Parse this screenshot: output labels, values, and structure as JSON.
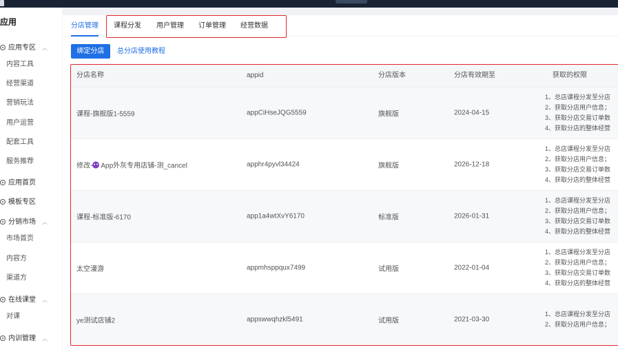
{
  "sidebar": {
    "title": "应用",
    "groups": [
      {
        "label": "应用专区",
        "icon": "app-zone-icon",
        "children": [
          "内容工具",
          "经营渠道",
          "营销玩法",
          "用户运营",
          "配套工具",
          "服务推荐"
        ]
      },
      {
        "label": "应用首页",
        "icon": "app-home-icon",
        "children": []
      },
      {
        "label": "模板专区",
        "icon": "template-icon",
        "children": []
      },
      {
        "label": "分销市场",
        "icon": "distribution-market-icon",
        "children": [
          "市场首页",
          "内容方",
          "渠道方"
        ]
      },
      {
        "label": "在线课堂",
        "icon": "online-class-icon",
        "children": [
          "对课"
        ]
      },
      {
        "label": "内训管理",
        "icon": "training-icon",
        "children": []
      }
    ]
  },
  "tabs": [
    {
      "label": "分店管理",
      "active": true
    },
    {
      "label": "课程分发",
      "active": false
    },
    {
      "label": "用户管理",
      "active": false
    },
    {
      "label": "订单管理",
      "active": false
    },
    {
      "label": "经营数据",
      "active": false
    }
  ],
  "actions": {
    "bind_button": "绑定分店",
    "tutorial_link": "总分店使用教程"
  },
  "table": {
    "columns": [
      "分店名称",
      "appid",
      "分店版本",
      "分店有效期至",
      "获取的权限"
    ],
    "rows": [
      {
        "name": "课程-旗舰版1-5559",
        "has_emoji": false,
        "appid": "appCiHseJQG5559",
        "version": "旗舰版",
        "expire": "2024-04-15",
        "perms": [
          "1、总店课程分发至分店",
          "2、获取分店用户信息；",
          "3、获取分店交易订单数",
          "4、获取分店的整体经营"
        ]
      },
      {
        "name_prefix": "修改-",
        "name": "App外灰专用店铺-测_cancel",
        "has_emoji": true,
        "appid": "apphr4pyvl34424",
        "version": "旗舰版",
        "expire": "2026-12-18",
        "perms": [
          "1、总店课程分发至分店",
          "2、获取分店用户信息；",
          "3、获取分店交易订单数",
          "4、获取分店的整体经营"
        ]
      },
      {
        "name": "课程-标准版-6170",
        "has_emoji": false,
        "appid": "app1a4wtXvY6170",
        "version": "标准版",
        "expire": "2026-01-31",
        "perms": [
          "1、总店课程分发至分店",
          "2、获取分店用户信息；",
          "3、获取分店交易订单数",
          "4、获取分店的整体经营"
        ]
      },
      {
        "name": "太空漫游",
        "has_emoji": false,
        "appid": "appmhsppqux7499",
        "version": "试用版",
        "expire": "2022-01-04",
        "perms": [
          "1、总店课程分发至分店",
          "2、获取分店用户信息；",
          "3、获取分店交易订单数",
          "4、获取分店的整体经营"
        ]
      },
      {
        "name": "ye测试店铺2",
        "has_emoji": false,
        "appid": "appswwqhzkl5491",
        "version": "试用版",
        "expire": "2021-03-30",
        "perms": [
          "1、总店课程分发至分店",
          "2、获取分店用户信息；"
        ]
      }
    ]
  },
  "colors": {
    "primary": "#1f6fe5",
    "highlight": "#e3262b",
    "topbar": "#1a2333"
  }
}
